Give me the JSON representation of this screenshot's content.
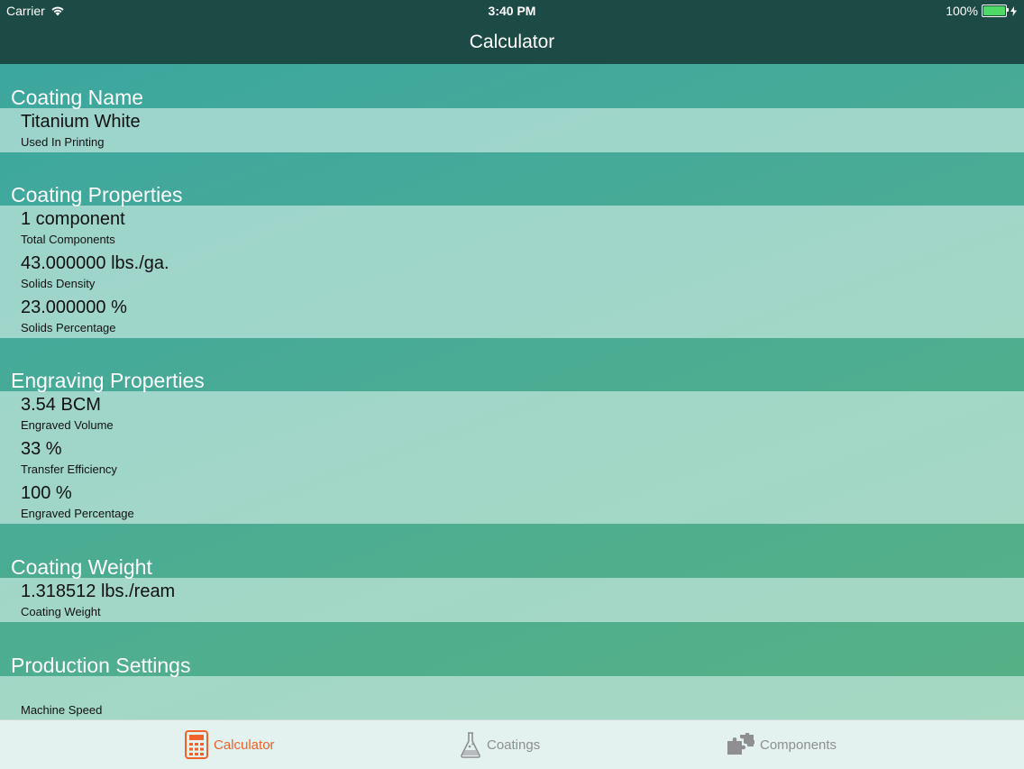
{
  "status_bar": {
    "carrier": "Carrier",
    "time": "3:40 PM",
    "battery": "100%"
  },
  "nav": {
    "title": "Calculator"
  },
  "sections": [
    {
      "title": "Coating Name",
      "rows": [
        {
          "value": "Titanium White",
          "label": "Used In Printing"
        }
      ]
    },
    {
      "title": "Coating Properties",
      "rows": [
        {
          "value": "1 component",
          "label": "Total Components"
        },
        {
          "value": "43.000000 lbs./ga.",
          "label": "Solids Density"
        },
        {
          "value": "23.000000 %",
          "label": "Solids Percentage"
        }
      ]
    },
    {
      "title": "Engraving Properties",
      "rows": [
        {
          "value": "3.54 BCM",
          "label": "Engraved Volume"
        },
        {
          "value": "33 %",
          "label": "Transfer Efficiency"
        },
        {
          "value": "100 %",
          "label": "Engraved Percentage"
        }
      ]
    },
    {
      "title": "Coating Weight",
      "rows": [
        {
          "value": "1.318512 lbs./ream",
          "label": "Coating Weight"
        }
      ]
    },
    {
      "title": "Production Settings",
      "rows": [
        {
          "value": "",
          "label": "Machine Speed"
        }
      ]
    }
  ],
  "tabs": [
    {
      "label": "Calculator",
      "icon": "calculator-icon",
      "active": true
    },
    {
      "label": "Coatings",
      "icon": "flask-icon",
      "active": false
    },
    {
      "label": "Components",
      "icon": "puzzle-piece-icon",
      "active": false
    }
  ],
  "colors": {
    "accent": "#f0622c",
    "bar": "#1c4a44",
    "inactive": "#8e8e93"
  }
}
